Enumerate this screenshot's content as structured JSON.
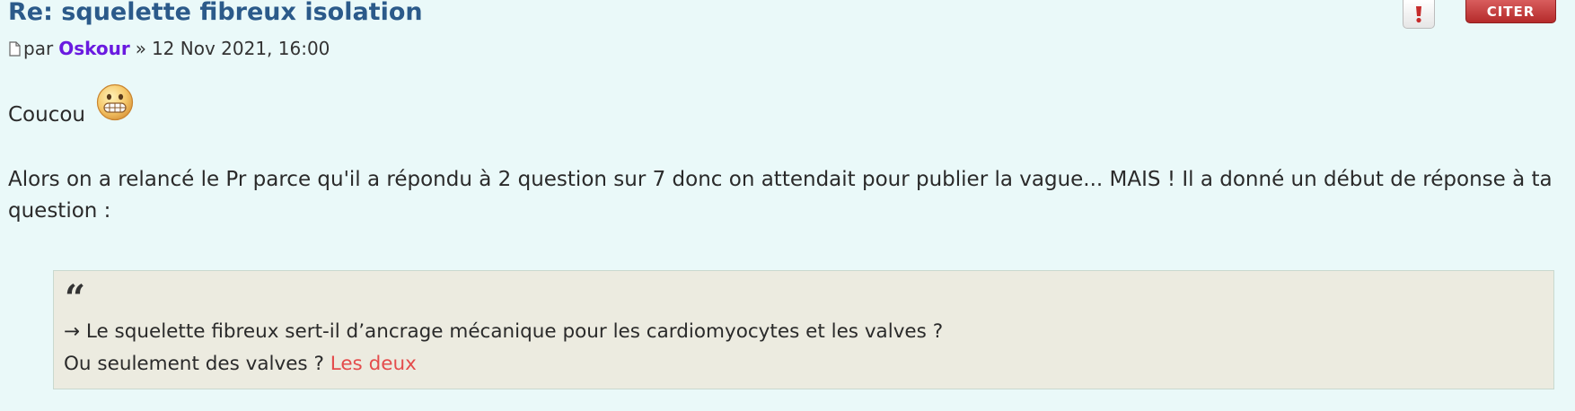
{
  "post": {
    "title": "Re: squelette fibreux isolation",
    "by_label": "par",
    "author": "Oskour",
    "separator": "»",
    "date": "12 Nov 2021, 16:00",
    "greeting": "Coucou",
    "paragraph": "Alors on a relancé le Pr parce qu'il a répondu à 2 question sur 7 donc on attendait pour publier la vague... MAIS ! Il a donné un début de réponse à ta question :",
    "quote": {
      "mark": "“",
      "line1": "→ Le squelette fibreux sert-il d’ancrage mécanique pour les cardiomyocytes et les valves ?",
      "line2_prefix": "Ou seulement des valves ?",
      "line2_answer": "Les deux"
    }
  },
  "buttons": {
    "report_icon": "exclamation-icon",
    "quote_label": "CITER"
  },
  "icons": {
    "post_icon": "document-icon",
    "smiley": "grin-smiley-icon"
  },
  "colors": {
    "background": "#eaf9f9",
    "title": "#2b5a8a",
    "author": "#6a1ae0",
    "quote_button": "#b52b2b",
    "quote_background": "#ecebe0",
    "answer": "#e44c4c"
  }
}
